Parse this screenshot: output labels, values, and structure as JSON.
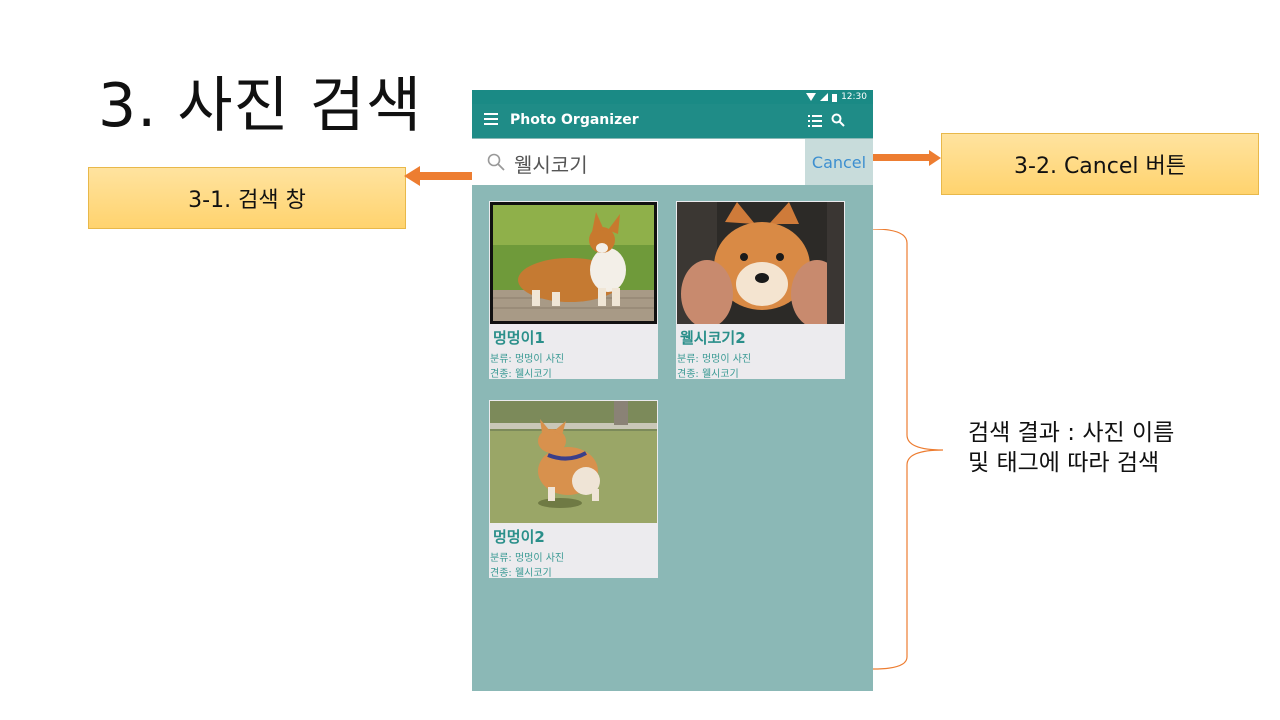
{
  "slide": {
    "title": "3. 사진 검색",
    "callout_search": "3-1. 검색 창",
    "callout_cancel": "3-2. Cancel 버튼",
    "result_note_line1": "검색 결과 : 사진 이름",
    "result_note_line2": "및 태그에 따라 검색"
  },
  "phone": {
    "status_time": "12:30",
    "app_title": "Photo Organizer",
    "search": {
      "value": "웰시코기",
      "placeholder": ""
    },
    "cancel_label": "Cancel",
    "results": [
      {
        "name": "멍멍이1",
        "category": "분류: 멍멍이 사진",
        "breed": "견종: 웰시코기"
      },
      {
        "name": "웰시코기2",
        "category": "분류: 멍멍이 사진",
        "breed": "견종: 웰시코기"
      },
      {
        "name": "멍멍이2",
        "category": "분류: 멍멍이 사진",
        "breed": "견종: 웰시코기"
      }
    ]
  },
  "colors": {
    "app_bar": "#1f8c87",
    "phone_bg": "#8bb8b6",
    "callout": "#ffd98a",
    "arrow": "#ed7d31",
    "cancel_text": "#3d8fd0",
    "card_title": "#2a8f8a"
  },
  "icons": [
    "menu-icon",
    "list-view-icon",
    "search-icon",
    "wifi-icon",
    "signal-icon",
    "battery-icon"
  ]
}
